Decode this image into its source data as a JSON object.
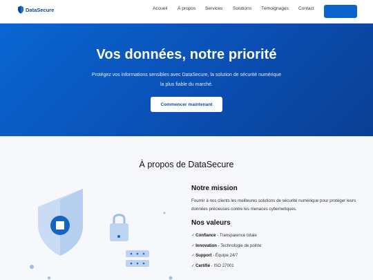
{
  "header": {
    "brand": "DataSecure",
    "nav": [
      "Accueil",
      "À propos",
      "Services",
      "Solutions",
      "Témoignages",
      "Contact"
    ],
    "cta_label": ""
  },
  "hero": {
    "title": "Vos données, notre priorité",
    "subtitle": "Protégez vos informations sensibles avec DataSecure, la solution de sécurité numérique la plus fiable du marché.",
    "button": "Commencer maintenant"
  },
  "about": {
    "title": "À propos de DataSecure",
    "mission_title": "Notre mission",
    "mission_text": "Fournir à nos clients les meilleures solutions de sécurité numérique pour protéger leurs données précieuses contre les menaces cybernetiques.",
    "values_title": "Nos valeurs",
    "values": [
      {
        "name": "Confiance",
        "desc": " - Transparence totale"
      },
      {
        "name": "Innovation",
        "desc": " - Technologie de pointe"
      },
      {
        "name": "Support",
        "desc": " - Équipe 24/7"
      },
      {
        "name": "Certifié",
        "desc": " - ISO 27001"
      }
    ]
  },
  "colors": {
    "primary": "#0b63ce",
    "primary_dark": "#0a3f93",
    "brand_text": "#0d47a1",
    "section_bg": "#f6f8fb"
  },
  "icons": [
    "shield-logo-icon",
    "shield-illustration",
    "padlock-icon",
    "server-rack-icon",
    "check-icon"
  ]
}
